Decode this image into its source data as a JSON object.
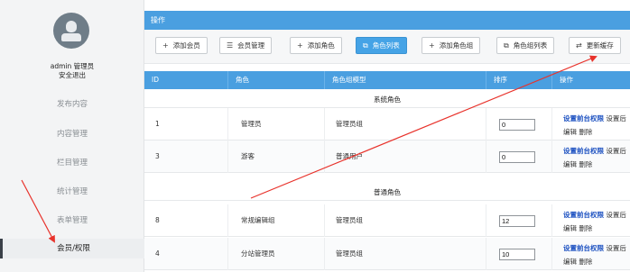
{
  "sidebar": {
    "user_name": "admin 管理员",
    "logout": "安全退出",
    "items": [
      {
        "label": "发布内容"
      },
      {
        "label": "内容管理"
      },
      {
        "label": "栏目管理"
      },
      {
        "label": "统计管理"
      },
      {
        "label": "表单管理"
      },
      {
        "label": "会员/权限",
        "active": true
      }
    ]
  },
  "panel": {
    "title": "操作"
  },
  "toolbar": {
    "buttons": [
      {
        "icon": "plus-icon",
        "glyph": "+",
        "label": "添加会员"
      },
      {
        "icon": "list-icon",
        "glyph": "☰",
        "label": "会员管理"
      },
      {
        "icon": "plus-icon",
        "glyph": "+",
        "label": "添加角色"
      },
      {
        "icon": "roles-icon",
        "glyph": "⧉",
        "label": "角色列表",
        "active": true
      },
      {
        "icon": "plus-icon",
        "glyph": "+",
        "label": "添加角色组"
      },
      {
        "icon": "roles-icon",
        "glyph": "⧉",
        "label": "角色组列表"
      },
      {
        "icon": "refresh-icon",
        "glyph": "⇄",
        "label": "更新缓存"
      }
    ]
  },
  "table": {
    "headers": [
      "ID",
      "角色",
      "角色组模型",
      "排序",
      "操作"
    ],
    "groups": [
      {
        "title": "系统角色",
        "rows": [
          {
            "id": "1",
            "role": "管理员",
            "group": "管理员组",
            "sort": "0"
          },
          {
            "id": "3",
            "role": "游客",
            "group": "普通用户",
            "sort": "0"
          }
        ]
      },
      {
        "title": "普通角色",
        "rows": [
          {
            "id": "8",
            "role": "常规编辑组",
            "group": "管理员组",
            "sort": "12"
          },
          {
            "id": "4",
            "role": "分站管理员",
            "group": "管理员组",
            "sort": "10"
          }
        ]
      }
    ],
    "ops": {
      "perm_front": "设置前台权限",
      "perm_back": "设置后",
      "edit": "编辑",
      "delete": "删除"
    }
  },
  "colors": {
    "header_blue": "#4a9fe0",
    "primary_button": "#45a3e6",
    "link_blue": "#1a4fc0",
    "annotation_red": "#e8322b"
  }
}
